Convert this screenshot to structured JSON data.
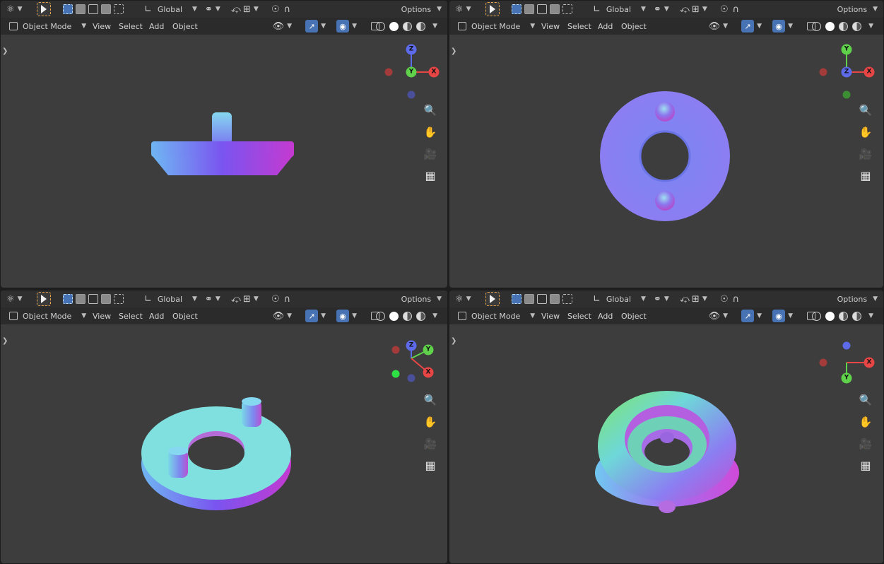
{
  "header": {
    "transform_orientation": "Global",
    "options_label": "Options",
    "mode_label": "Object Mode",
    "menus": [
      "View",
      "Select",
      "Add",
      "Object"
    ]
  },
  "icons": {
    "transform_pivot": "transform-pivot-icon",
    "select_tool": "select-arrow-icon",
    "snap": "magnet-icon",
    "proportional": "proportional-edit-icon",
    "visibility": "eye-icon",
    "gizmo": "gizmo-icon",
    "overlay": "overlay-icon",
    "xray": "xray-icon",
    "wireframe": "wireframe-shading-icon",
    "solid": "solid-shading-icon",
    "material": "material-shading-icon",
    "rendered": "rendered-shading-icon",
    "zoom": "zoom-icon",
    "pan": "hand-icon",
    "camera": "camera-icon",
    "grid": "grid-icon"
  },
  "gizmo": {
    "top_left": {
      "axes": [
        "Z",
        "Y",
        "X"
      ]
    },
    "top_right": {
      "axes": [
        "Y",
        "Z",
        "X"
      ]
    },
    "bottom_left": {
      "axes": [
        "Z",
        "Y",
        "X"
      ]
    },
    "bottom_right": {
      "axes": [
        "X",
        "Y"
      ]
    }
  },
  "colors": {
    "x_axis": "#e84545",
    "y_axis": "#5fd14a",
    "z_axis": "#5d6bea",
    "accent": "#4772b3",
    "viewport_bg": "#3d3d3d",
    "header_bg": "#2f2f2f"
  }
}
